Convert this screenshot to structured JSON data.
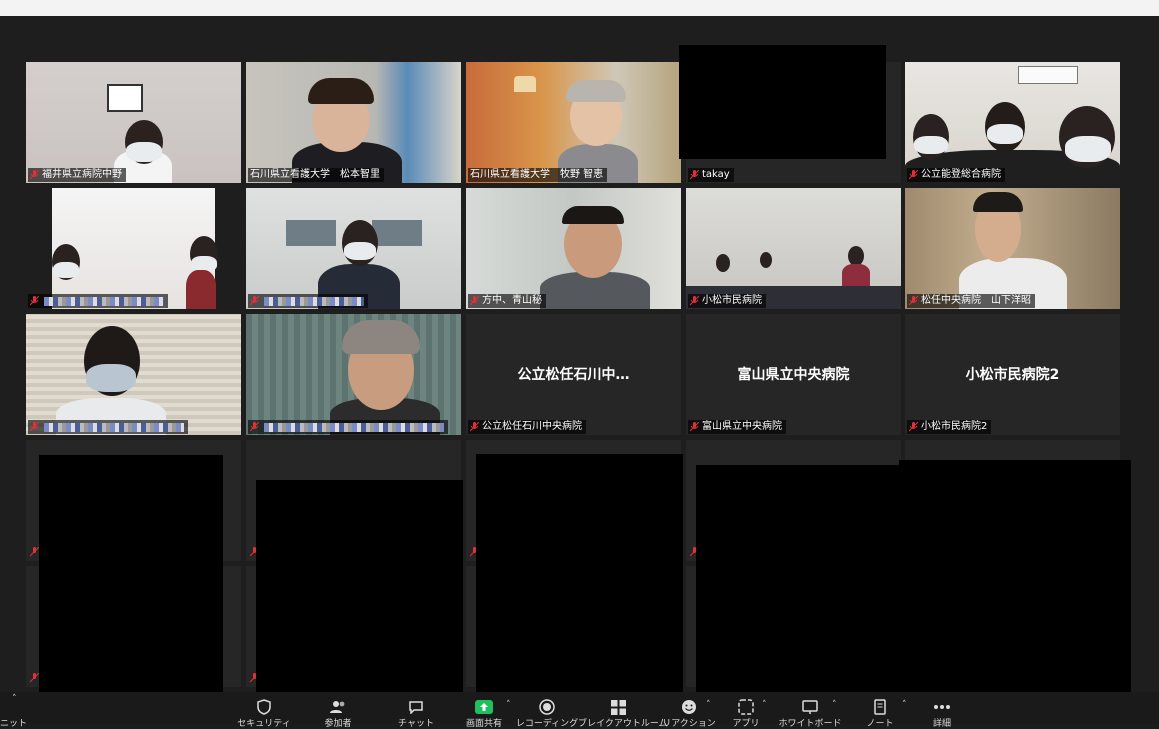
{
  "participants": [
    {
      "name": "福井県立病院中野"
    },
    {
      "name": "石川県立看護大学　松本智里"
    },
    {
      "name": "石川県立看護大学　牧野 智恵"
    },
    {
      "name": "takay"
    },
    {
      "name": "公立能登総合病院"
    },
    {
      "name": ""
    },
    {
      "name": ""
    },
    {
      "name": "方中、青山秘"
    },
    {
      "name": "小松市民病院"
    },
    {
      "name": "松任中央病院　山下洋昭"
    },
    {
      "name": ""
    },
    {
      "name": ""
    },
    {
      "name": "公立松任石川中央病院",
      "display": "公立松任石川中…"
    },
    {
      "name": "富山県立中央病院",
      "display": "富山県立中央病院"
    },
    {
      "name": "小松市民病院2",
      "display": "小松市民病院2"
    }
  ],
  "toolbar": {
    "left_label": "ニット",
    "items": [
      {
        "label": "セキュリティ",
        "icon": "shield-icon"
      },
      {
        "label": "参加者",
        "icon": "participants-icon"
      },
      {
        "label": "チャット",
        "icon": "chat-icon"
      },
      {
        "label": "画面共有",
        "icon": "share-screen-icon"
      },
      {
        "label": "レコーディング",
        "icon": "record-icon"
      },
      {
        "label": "ブレイクアウトルーム",
        "icon": "breakout-icon"
      },
      {
        "label": "リアクション",
        "icon": "reaction-icon"
      },
      {
        "label": "アプリ",
        "icon": "apps-icon"
      },
      {
        "label": "ホワイトボード",
        "icon": "whiteboard-icon"
      },
      {
        "label": "ノート",
        "icon": "notes-icon"
      },
      {
        "label": "詳細",
        "icon": "more-icon"
      }
    ]
  },
  "colors": {
    "active_speaker": "#c8d64d",
    "share_green": "#1fbf5f",
    "mute_red": "#e0313a"
  }
}
